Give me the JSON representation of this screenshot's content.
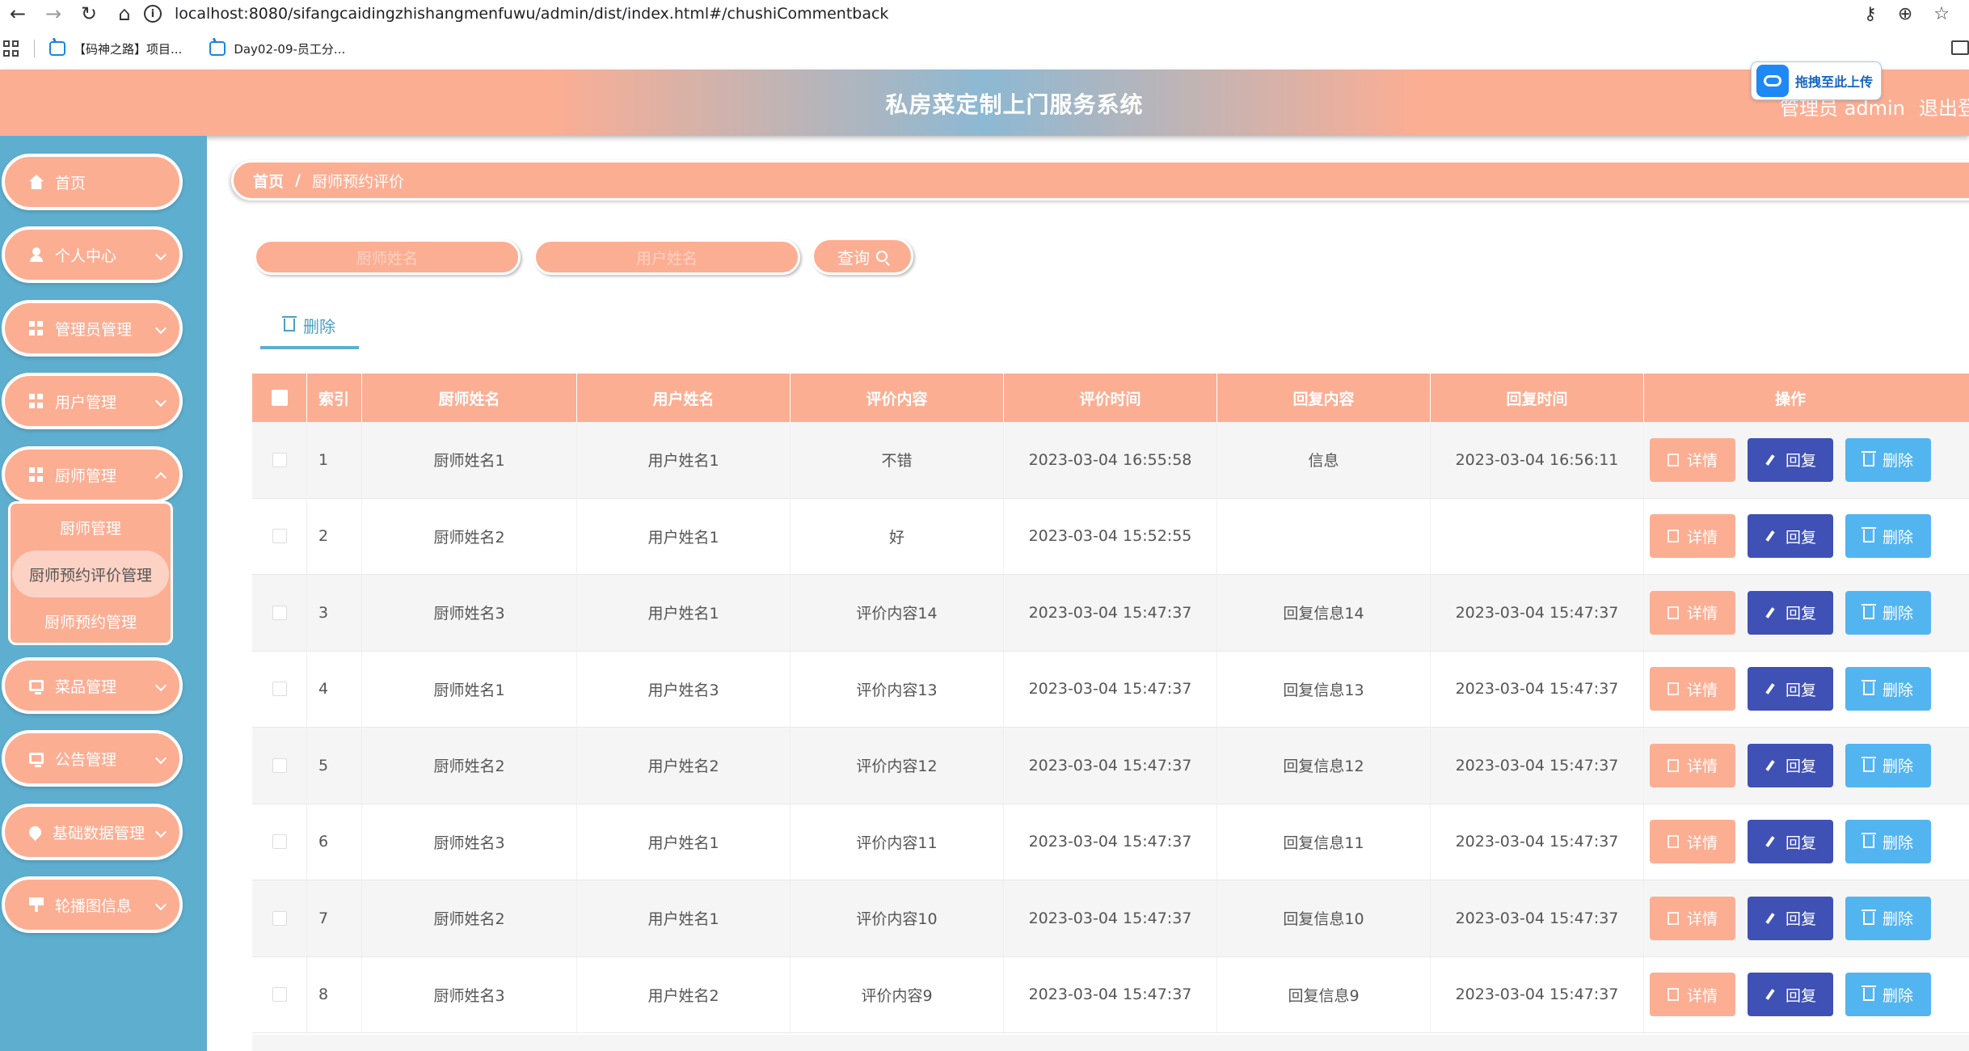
{
  "browser": {
    "url": "localhost:8080/sifangcaidingzhishangmenfuwu/admin/dist/index.html#/chushiCommentback",
    "bookmarks": [
      "【码神之路】项目...",
      "Day02-09-员工分..."
    ]
  },
  "header": {
    "title": "私房菜定制上门服务系统",
    "user": "管理员 admin",
    "logout": "退出登",
    "upload_badge": "拖拽至此上传"
  },
  "sidebar": {
    "items": [
      {
        "label": "首页",
        "icon": "home-icon"
      },
      {
        "label": "个人中心",
        "icon": "user-icon"
      },
      {
        "label": "管理员管理",
        "icon": "grid-icon"
      },
      {
        "label": "用户管理",
        "icon": "grid-icon"
      },
      {
        "label": "厨师管理",
        "icon": "grid-icon"
      },
      {
        "label": "菜品管理",
        "icon": "monitor-icon"
      },
      {
        "label": "公告管理",
        "icon": "monitor-icon"
      },
      {
        "label": "基础数据管理",
        "icon": "pin-icon"
      },
      {
        "label": "轮播图信息",
        "icon": "download-icon"
      }
    ],
    "submenu": [
      "厨师管理",
      "厨师预约评价管理",
      "厨师预约管理"
    ],
    "active_submenu": "厨师预约评价管理"
  },
  "breadcrumb": {
    "home": "首页",
    "current": "厨师预约评价"
  },
  "search": {
    "chef_placeholder": "厨师姓名",
    "user_placeholder": "用户姓名",
    "query_label": "查询"
  },
  "toolbar": {
    "delete_label": "删除"
  },
  "table": {
    "headers": [
      "索引",
      "厨师姓名",
      "用户姓名",
      "评价内容",
      "评价时间",
      "回复内容",
      "回复时间",
      "操作"
    ],
    "rows": [
      {
        "index": "1",
        "chef": "厨师姓名1",
        "user": "用户姓名1",
        "content": "不错",
        "time": "2023-03-04 16:55:58",
        "reply": "信息",
        "reply_time": "2023-03-04 16:56:11"
      },
      {
        "index": "2",
        "chef": "厨师姓名2",
        "user": "用户姓名1",
        "content": "好",
        "time": "2023-03-04 15:52:55",
        "reply": "",
        "reply_time": ""
      },
      {
        "index": "3",
        "chef": "厨师姓名3",
        "user": "用户姓名1",
        "content": "评价内容14",
        "time": "2023-03-04 15:47:37",
        "reply": "回复信息14",
        "reply_time": "2023-03-04 15:47:37"
      },
      {
        "index": "4",
        "chef": "厨师姓名1",
        "user": "用户姓名3",
        "content": "评价内容13",
        "time": "2023-03-04 15:47:37",
        "reply": "回复信息13",
        "reply_time": "2023-03-04 15:47:37"
      },
      {
        "index": "5",
        "chef": "厨师姓名2",
        "user": "用户姓名2",
        "content": "评价内容12",
        "time": "2023-03-04 15:47:37",
        "reply": "回复信息12",
        "reply_time": "2023-03-04 15:47:37"
      },
      {
        "index": "6",
        "chef": "厨师姓名3",
        "user": "用户姓名1",
        "content": "评价内容11",
        "time": "2023-03-04 15:47:37",
        "reply": "回复信息11",
        "reply_time": "2023-03-04 15:47:37"
      },
      {
        "index": "7",
        "chef": "厨师姓名2",
        "user": "用户姓名1",
        "content": "评价内容10",
        "time": "2023-03-04 15:47:37",
        "reply": "回复信息10",
        "reply_time": "2023-03-04 15:47:37"
      },
      {
        "index": "8",
        "chef": "厨师姓名3",
        "user": "用户姓名2",
        "content": "评价内容9",
        "time": "2023-03-04 15:47:37",
        "reply": "回复信息9",
        "reply_time": "2023-03-04 15:47:37"
      }
    ],
    "actions": {
      "detail": "详情",
      "reply": "回复",
      "delete": "删除"
    }
  },
  "colors": {
    "primary": "#fcae93",
    "sidebar": "#5eaecf",
    "reply_button": "#3f51b5",
    "delete_button": "#52b5f0"
  }
}
